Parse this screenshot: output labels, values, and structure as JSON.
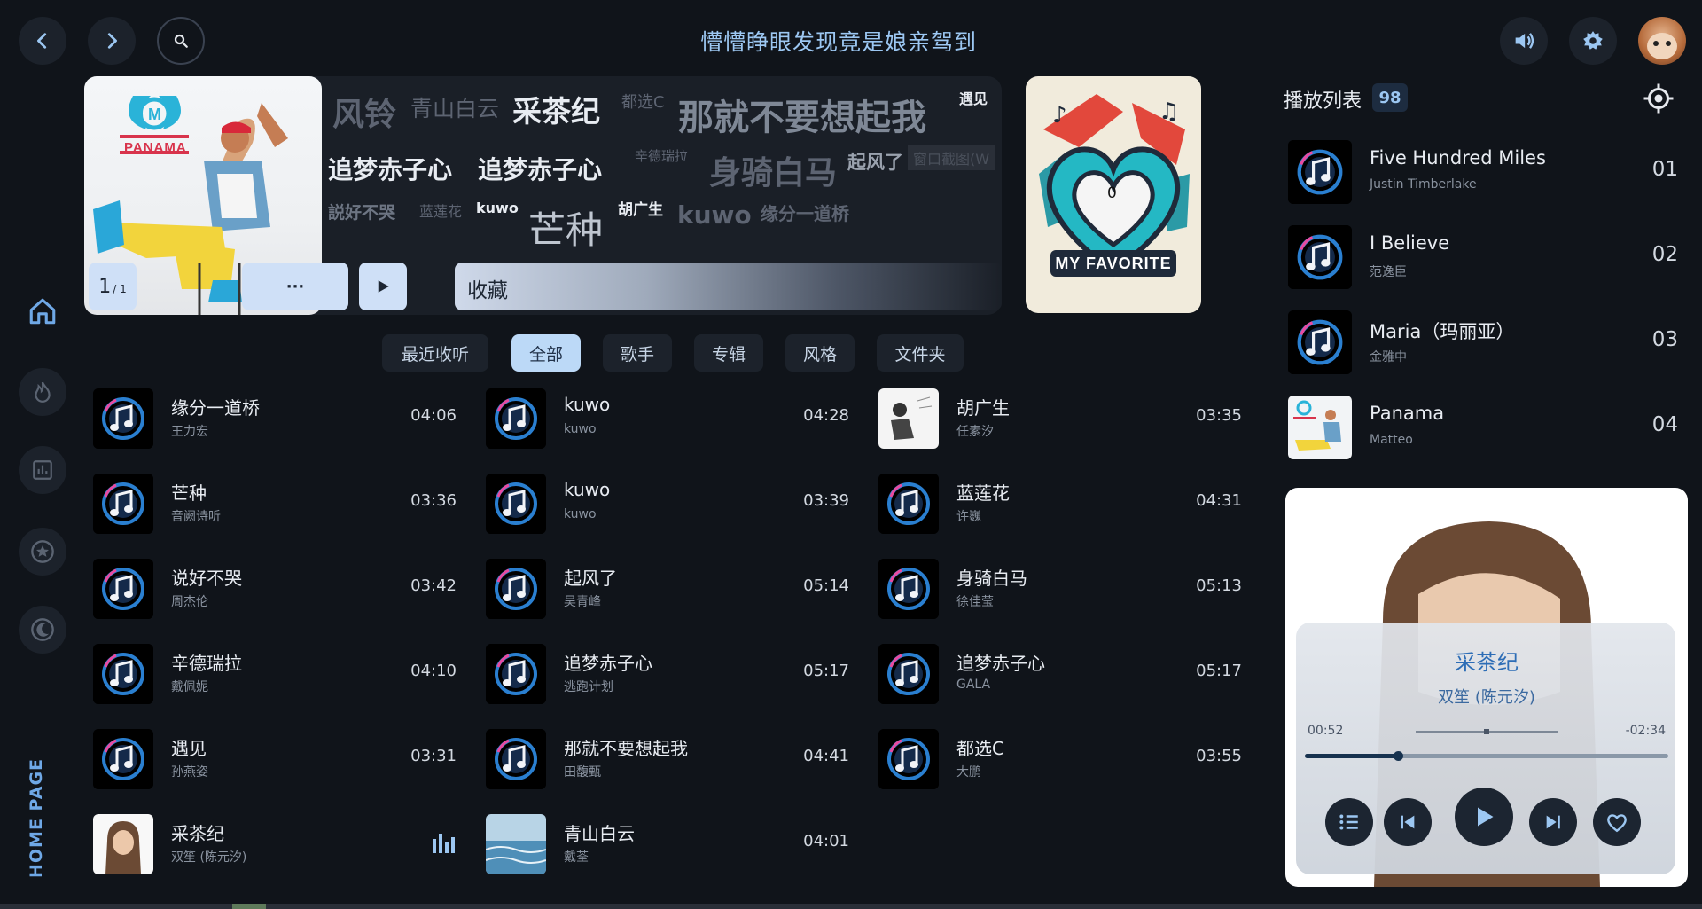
{
  "header": {
    "title": "懵懵睁眼发现竟是娘亲驾到",
    "back_icon": "chevron-left-icon",
    "forward_icon": "chevron-right-icon",
    "search_icon": "search-icon",
    "volume_icon": "volume-icon",
    "settings_icon": "gear-icon",
    "avatar_icon": "avatar"
  },
  "sidebar": {
    "items": [
      {
        "icon": "home-icon",
        "active": true
      },
      {
        "icon": "fire-icon",
        "active": false
      },
      {
        "icon": "chart-icon",
        "active": false
      },
      {
        "icon": "star-icon",
        "active": false
      },
      {
        "icon": "moon-icon",
        "active": false
      }
    ],
    "page_label": "HOME PAGE"
  },
  "hero": {
    "page_current": "1",
    "page_total": "/ 1",
    "more_label": "···",
    "collect_label": "收藏",
    "cloud_words": [
      "风铃",
      "青山白云",
      "采茶纪",
      "都选C",
      "那就不要想起我",
      "遇见",
      "追梦赤子心",
      "追梦赤子心",
      "辛德瑞拉",
      "身骑白马",
      "起风了",
      "説好不哭",
      "蓝莲花",
      "kuwo",
      "芒种",
      "胡广生",
      "kuwo",
      "缘分一道桥",
      "窗口截图(W"
    ],
    "album_brand": "PANAMA",
    "favorite_label": "MY FAVORITE",
    "favorite_count": "0"
  },
  "tabs": [
    "最近收听",
    "全部",
    "歌手",
    "专辑",
    "风格",
    "文件夹"
  ],
  "active_tab": "全部",
  "songs": {
    "col1": [
      {
        "title": "缘分一道桥",
        "artist": "王力宏",
        "duration": "04:06"
      },
      {
        "title": "芒种",
        "artist": "音阙诗听",
        "duration": "03:36"
      },
      {
        "title": "说好不哭",
        "artist": "周杰伦",
        "duration": "03:42"
      },
      {
        "title": "辛德瑞拉",
        "artist": "戴佩妮",
        "duration": "04:10"
      },
      {
        "title": "遇见",
        "artist": "孙燕姿",
        "duration": "03:31"
      },
      {
        "title": "采茶纪",
        "artist": "双笙 (陈元汐)",
        "duration": ""
      }
    ],
    "col2": [
      {
        "title": "kuwo",
        "artist": "kuwo",
        "duration": "04:28"
      },
      {
        "title": "kuwo",
        "artist": "kuwo",
        "duration": "03:39"
      },
      {
        "title": "起风了",
        "artist": "吴青峰",
        "duration": "05:14"
      },
      {
        "title": "追梦赤子心",
        "artist": "逃跑计划",
        "duration": "05:17"
      },
      {
        "title": "那就不要想起我",
        "artist": "田馥甄",
        "duration": "04:41"
      },
      {
        "title": "青山白云",
        "artist": "戴荃",
        "duration": "04:01"
      }
    ],
    "col3": [
      {
        "title": "胡广生",
        "artist": "任素汐",
        "duration": "03:35"
      },
      {
        "title": "蓝莲花",
        "artist": "许巍",
        "duration": "04:31"
      },
      {
        "title": "身骑白马",
        "artist": "徐佳莹",
        "duration": "05:13"
      },
      {
        "title": "追梦赤子心",
        "artist": "GALA",
        "duration": "05:17"
      },
      {
        "title": "都选C",
        "artist": "大鹏",
        "duration": "03:55"
      }
    ]
  },
  "playlist": {
    "title": "播放列表",
    "count": "98",
    "locate_icon": "locate-icon",
    "items": [
      {
        "title": "Five Hundred Miles",
        "artist": "Justin Timberlake",
        "num": "01"
      },
      {
        "title": "I Believe",
        "artist": "范逸臣",
        "num": "02"
      },
      {
        "title": "Maria（玛丽亚）",
        "artist": "金雅中",
        "num": "03"
      },
      {
        "title": "Panama",
        "artist": "Matteo",
        "num": "04"
      }
    ]
  },
  "player": {
    "title": "采茶纪",
    "artist": "双笙 (陈元汐)",
    "elapsed": "00:52",
    "remaining": "-02:34",
    "progress": 0.255
  },
  "colors": {
    "background": "#10141a",
    "accent": "#9cc7f2",
    "active_tab": "#bcd9f7"
  }
}
